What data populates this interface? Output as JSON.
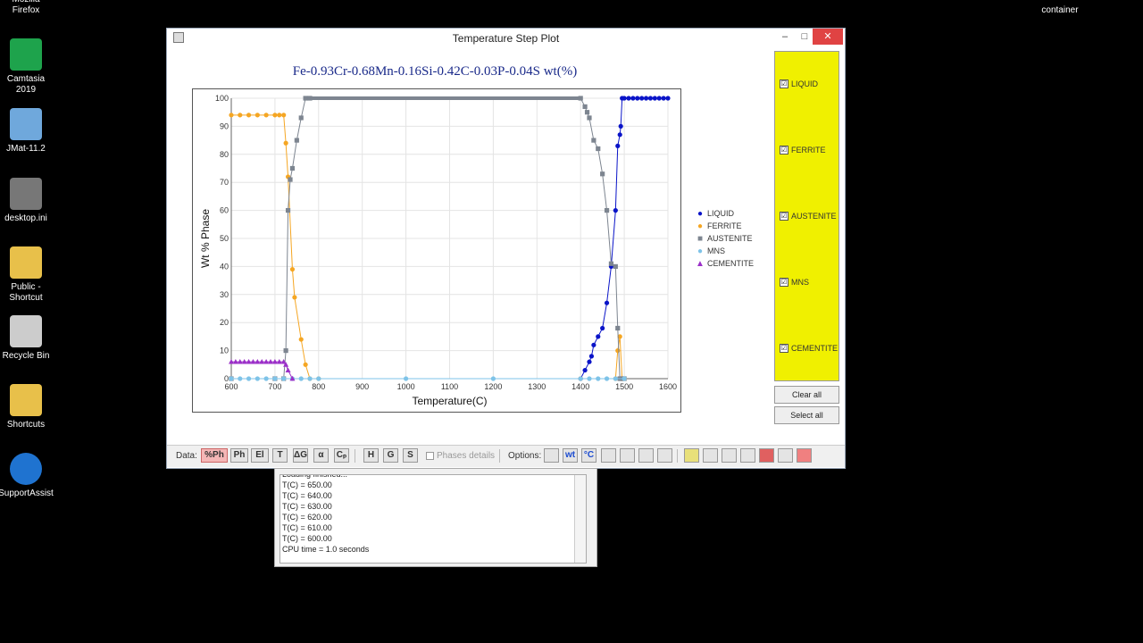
{
  "desktop": {
    "icons": [
      {
        "label": "Mozilla\nFirefox",
        "color": "#e66000"
      },
      {
        "label": "Camtasia\n2019",
        "color": "#1ea34c"
      },
      {
        "label": "JMat-11.2",
        "color": "#6fa8dc"
      },
      {
        "label": "desktop.ini",
        "color": "#777777"
      },
      {
        "label": "Public -\nShortcut",
        "color": "#e8c04a"
      },
      {
        "label": "Recycle Bin",
        "color": "#cccccc"
      },
      {
        "label": "Shortcuts",
        "color": "#e8c04a"
      },
      {
        "label": "SupportAssist",
        "color": "#1f73d0"
      }
    ],
    "top_right_label": "container"
  },
  "window": {
    "title": "Temperature Step Plot",
    "minimize": "–",
    "maximize": "□",
    "close": "✕"
  },
  "plot": {
    "title": "Fe-0.93Cr-0.68Mn-0.16Si-0.42C-0.03P-0.04S wt(%)"
  },
  "chart_data": {
    "type": "line",
    "xlabel": "Temperature(C)",
    "ylabel": "Wt % Phase",
    "xlim": [
      600,
      1600
    ],
    "ylim": [
      0,
      100
    ],
    "x_ticks": [
      600,
      700,
      800,
      900,
      1000,
      1100,
      1200,
      1300,
      1400,
      1500,
      1600
    ],
    "y_ticks": [
      0,
      10,
      20,
      30,
      40,
      50,
      60,
      70,
      80,
      90,
      100
    ],
    "grid": true,
    "legend_position": "right",
    "series": [
      {
        "name": "LIQUID",
        "color": "#0a14c8",
        "marker": "circle",
        "x": [
          600,
          700,
          1400,
          1410,
          1420,
          1425,
          1430,
          1440,
          1450,
          1460,
          1470,
          1480,
          1485,
          1490,
          1492,
          1495,
          1500,
          1510,
          1520,
          1530,
          1540,
          1550,
          1560,
          1570,
          1580,
          1590,
          1600
        ],
        "y": [
          0,
          0,
          0,
          3,
          6,
          8,
          12,
          15,
          18,
          27,
          40,
          60,
          83,
          87,
          90,
          100,
          100,
          100,
          100,
          100,
          100,
          100,
          100,
          100,
          100,
          100,
          100
        ]
      },
      {
        "name": "FERRITE",
        "color": "#f5a623",
        "marker": "circle",
        "x": [
          600,
          620,
          640,
          660,
          680,
          700,
          710,
          720,
          725,
          730,
          740,
          745,
          760,
          770,
          780,
          800,
          1400,
          1480,
          1485,
          1490,
          1495,
          1500
        ],
        "y": [
          94,
          94,
          94,
          94,
          94,
          94,
          94,
          94,
          84,
          72,
          39,
          29,
          14,
          5,
          0,
          0,
          0,
          0,
          10,
          15,
          0,
          0
        ]
      },
      {
        "name": "AUSTENITE",
        "color": "#7d8590",
        "marker": "square",
        "x": [
          600,
          700,
          720,
          725,
          730,
          735,
          740,
          750,
          760,
          770,
          780,
          1400,
          1410,
          1415,
          1420,
          1430,
          1440,
          1450,
          1460,
          1470,
          1480,
          1485,
          1490,
          1495,
          1500
        ],
        "y": [
          0,
          0,
          0,
          10,
          60,
          71,
          75,
          85,
          93,
          100,
          100,
          100,
          97,
          95,
          93,
          85,
          82,
          73,
          60,
          41,
          40,
          18,
          0,
          0,
          0
        ]
      },
      {
        "name": "MNS",
        "color": "#7ec3e8",
        "marker": "circle",
        "x": [
          600,
          620,
          640,
          660,
          680,
          700,
          720,
          740,
          760,
          780,
          800,
          1000,
          1200,
          1400,
          1420,
          1440,
          1460,
          1480,
          1500
        ],
        "y": [
          0,
          0,
          0,
          0,
          0,
          0,
          0,
          0,
          0,
          0,
          0,
          0,
          0,
          0,
          0,
          0,
          0,
          0,
          0
        ]
      },
      {
        "name": "CEMENTITE",
        "color": "#9b30c8",
        "marker": "triangle",
        "x": [
          600,
          610,
          620,
          630,
          640,
          650,
          660,
          670,
          680,
          690,
          700,
          710,
          720,
          725,
          730,
          740
        ],
        "y": [
          6,
          6,
          6,
          6,
          6,
          6,
          6,
          6,
          6,
          6,
          6,
          6,
          6,
          5,
          3,
          0
        ]
      }
    ]
  },
  "phase_panel": {
    "items": [
      "LIQUID",
      "FERRITE",
      "AUSTENITE",
      "MNS",
      "CEMENTITE"
    ],
    "check": "☑",
    "clear_all": "Clear all",
    "select_all": "Select all"
  },
  "toolbar": {
    "data_label": "Data:",
    "buttons_data": [
      "%Ph",
      "Ph",
      "El",
      "T",
      "ΔG",
      "α",
      "Cₚ"
    ],
    "buttons_hgs": [
      "H",
      "G",
      "S"
    ],
    "phases_details": "Phases details",
    "options_label": "Options:",
    "buttons_options": [
      "wt",
      "°C"
    ]
  },
  "console": {
    "lines": [
      "Loading finished...",
      "T(C) = 650.00",
      "T(C) = 640.00",
      "T(C) = 630.00",
      "T(C) = 620.00",
      "T(C) = 610.00",
      "T(C) = 600.00",
      "CPU time =    1.0 seconds"
    ]
  }
}
